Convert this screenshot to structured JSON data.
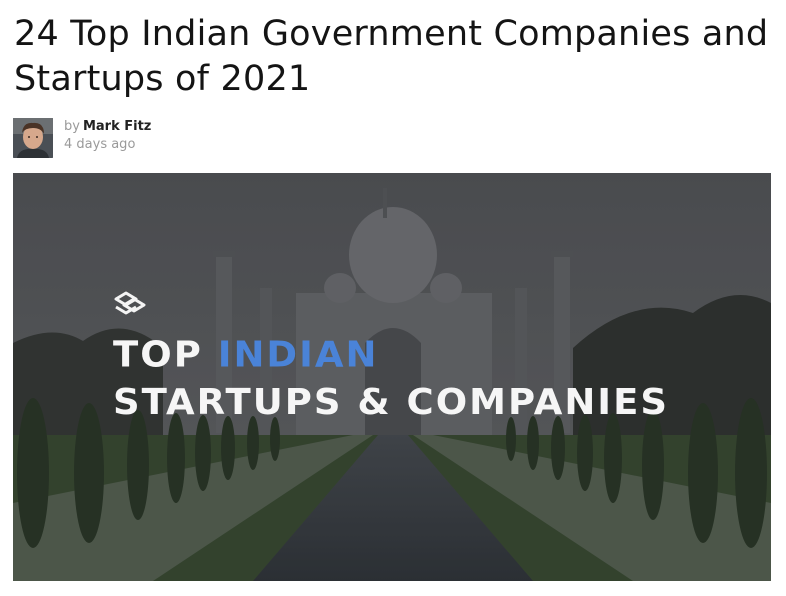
{
  "article": {
    "title": "24 Top Indian Government Companies and Startups of 2021",
    "by_label": "by",
    "author": "Mark Fitz",
    "published": "4 days ago"
  },
  "hero": {
    "line1_part1": "TOP",
    "line1_part2": "INDIAN",
    "line2": "STARTUPS & COMPANIES",
    "accent_color": "#4a83d8",
    "icon": "logo-mark-icon"
  }
}
